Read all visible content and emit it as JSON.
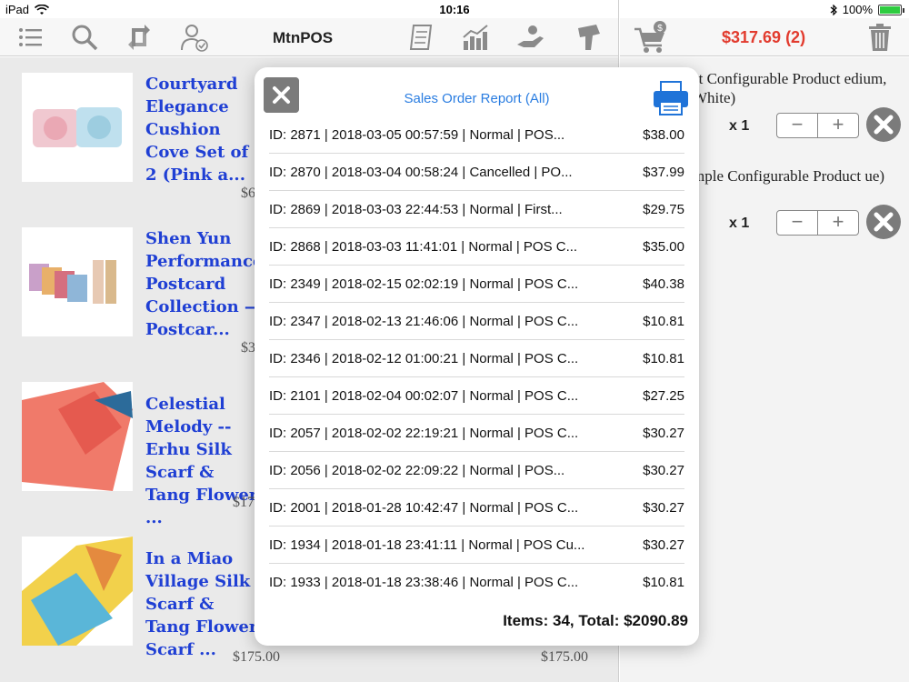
{
  "status_bar": {
    "device": "iPad",
    "time": "10:16",
    "battery": "100%"
  },
  "toolbar": {
    "title": "MtnPOS",
    "icons": [
      "menu-list-icon",
      "search-icon",
      "sync-icon",
      "customer-icon",
      "report-icon",
      "chart-icon",
      "payment-icon",
      "scanner-icon"
    ]
  },
  "cart_header": {
    "total": "$317.69 (2)"
  },
  "products": [
    {
      "name": "Courtyard Elegance Cushion Cove Set of 2 (Pink a...",
      "price": "$6",
      "price2": ""
    },
    {
      "name": "Shen Yun Performance Postcard Collection — Postcar...",
      "price": "$3",
      "price2": ""
    },
    {
      "name": "Celestial Melody -- Erhu Silk Scarf & Tang Flower ...",
      "price": "$17",
      "price2": ""
    },
    {
      "name": "In a Miao Village Silk Scarf & Tang Flower Scarf ...",
      "price": "$175.00",
      "price2": "$175.00"
    }
  ],
  "cart_items": [
    {
      "name": "st Configurable Product edium, White)",
      "qty": "x 1"
    },
    {
      "name": "mple Configurable Product ue)",
      "qty": "x 1"
    }
  ],
  "modal": {
    "title": "Sales Order Report (All)",
    "rows": [
      {
        "text": "ID: 2871 | 2018-03-05 00:57:59 | Normal | POS...",
        "amount": "$38.00"
      },
      {
        "text": "ID: 2870 | 2018-03-04 00:58:24 | Cancelled | PO...",
        "amount": "$37.99"
      },
      {
        "text": "ID: 2869 | 2018-03-03 22:44:53 | Normal | First...",
        "amount": "$29.75"
      },
      {
        "text": "ID: 2868 | 2018-03-03 11:41:01 | Normal | POS C...",
        "amount": "$35.00"
      },
      {
        "text": "ID: 2349 | 2018-02-15 02:02:19 | Normal | POS C...",
        "amount": "$40.38"
      },
      {
        "text": "ID: 2347 | 2018-02-13 21:46:06 | Normal | POS C...",
        "amount": "$10.81"
      },
      {
        "text": "ID: 2346 | 2018-02-12 01:00:21 | Normal | POS C...",
        "amount": "$10.81"
      },
      {
        "text": "ID: 2101 | 2018-02-04 00:02:07 | Normal | POS C...",
        "amount": "$27.25"
      },
      {
        "text": "ID: 2057 | 2018-02-02 22:19:21 | Normal | POS C...",
        "amount": "$30.27"
      },
      {
        "text": "ID: 2056 | 2018-02-02 22:09:22 | Normal | POS...",
        "amount": "$30.27"
      },
      {
        "text": "ID: 2001 | 2018-01-28 10:42:47 | Normal | POS C...",
        "amount": "$30.27"
      },
      {
        "text": "ID: 1934 | 2018-01-18 23:41:11 | Normal | POS Cu...",
        "amount": "$30.27"
      },
      {
        "text": "ID: 1933 | 2018-01-18 23:38:46 | Normal | POS C...",
        "amount": "$10.81"
      }
    ],
    "summary": "Items: 34, Total: $2090.89"
  }
}
